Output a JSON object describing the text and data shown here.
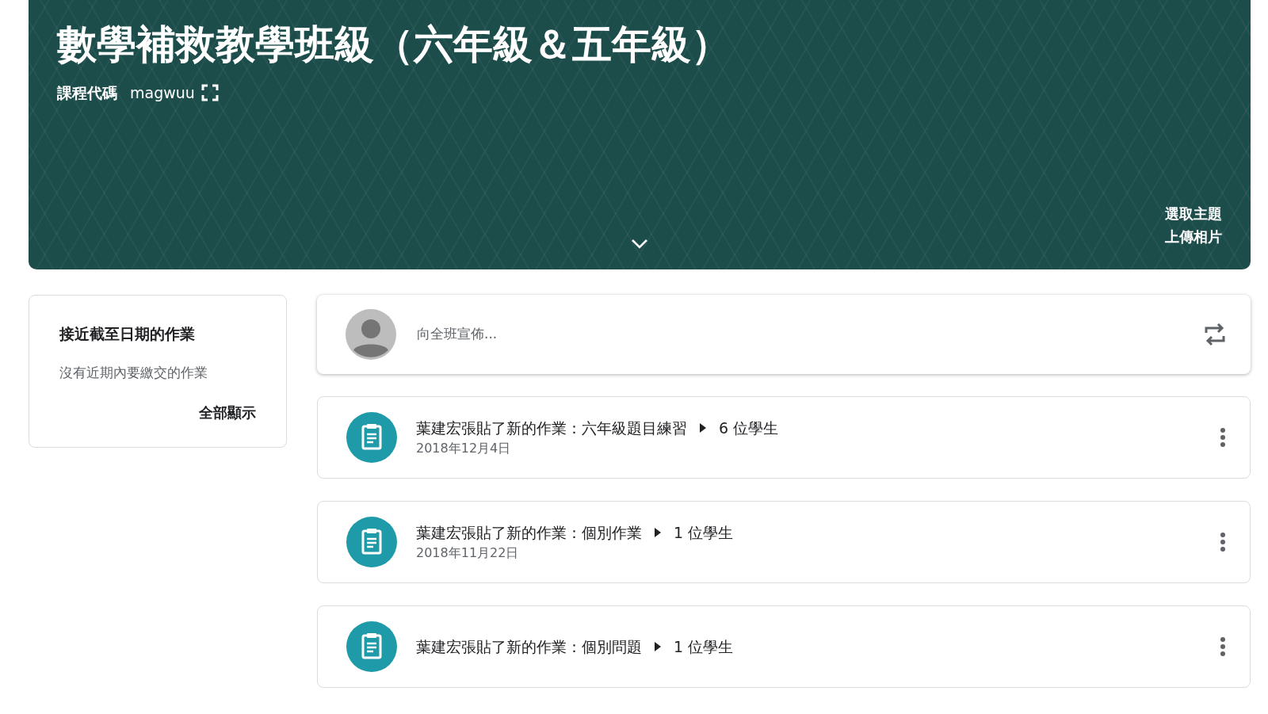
{
  "banner": {
    "title": "數學補救教學班級（六年級＆五年級）",
    "class_code_label": "課程代碼",
    "class_code": "magwuu",
    "links": [
      "選取主題",
      "上傳相片"
    ]
  },
  "upcoming": {
    "title": "接近截至日期的作業",
    "empty_text": "沒有近期內要繳交的作業",
    "view_all": "全部顯示"
  },
  "announce": {
    "placeholder": "向全班宣佈..."
  },
  "posts": [
    {
      "title": "葉建宏張貼了新的作業：六年級題目練習",
      "audience": "6 位學生",
      "date": "2018年12月4日"
    },
    {
      "title": "葉建宏張貼了新的作業：個別作業",
      "audience": "1 位學生",
      "date": "2018年11月22日"
    },
    {
      "title": "葉建宏張貼了新的作業：個別問題",
      "audience": "1 位學生"
    }
  ]
}
